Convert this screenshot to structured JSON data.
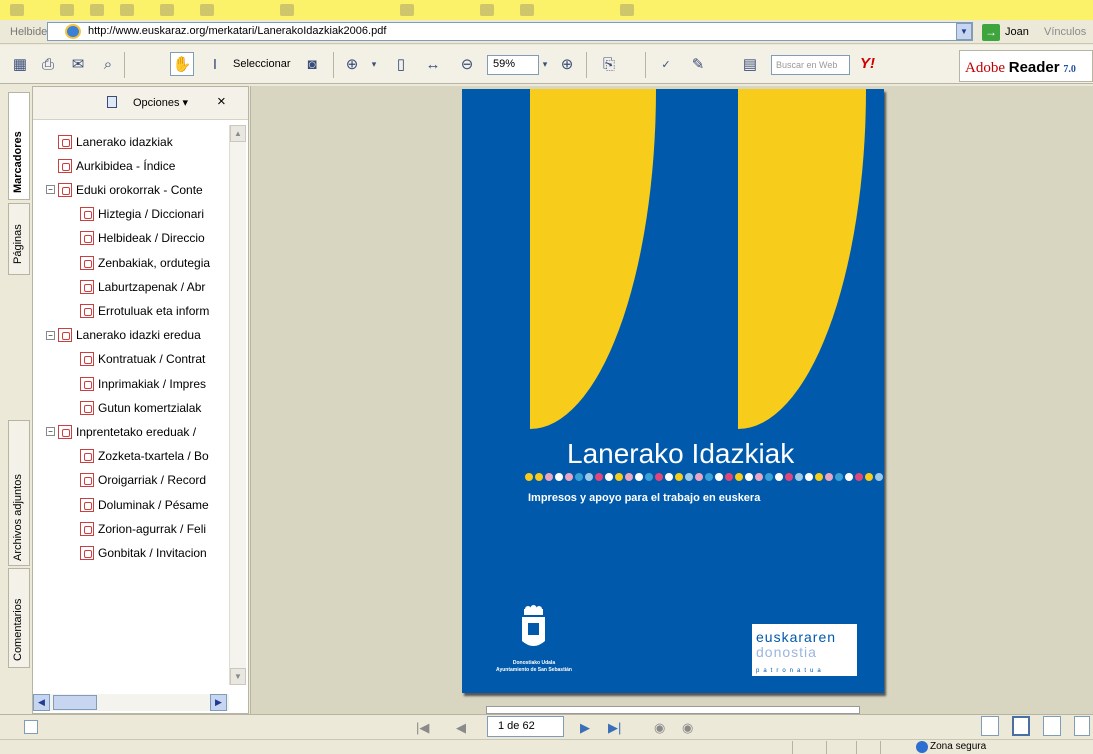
{
  "browser": {
    "address_label": "Helbidea",
    "url": "http://www.euskaraz.org/merkatari/LanerakoIdazkiak2006.pdf",
    "go_label": "Joan",
    "links_label": "Vínculos"
  },
  "toolbar": {
    "select_label": "Seleccionar",
    "zoom_value": "59%",
    "search_placeholder": "Buscar en Web",
    "yahoo_label": "Y!",
    "brand_adobe": "Adobe",
    "brand_reader": "Reader",
    "brand_version": "7.0"
  },
  "side_tabs": [
    "Marcadores",
    "Páginas",
    "Archivos adjuntos",
    "Comentarios"
  ],
  "panel": {
    "options_label": "Opciones",
    "close_label": "×"
  },
  "bookmarks": [
    {
      "label": "Lanerako idazkiak",
      "level": 0,
      "expander": ""
    },
    {
      "label": "Aurkibidea - Índice",
      "level": 0,
      "expander": ""
    },
    {
      "label": "Eduki orokorrak - Conte",
      "level": 0,
      "expander": "−"
    },
    {
      "label": "Hiztegia / Diccionari",
      "level": 1,
      "expander": ""
    },
    {
      "label": "Helbideak / Direccio",
      "level": 1,
      "expander": ""
    },
    {
      "label": "Zenbakiak, ordutegia",
      "level": 1,
      "expander": ""
    },
    {
      "label": "Laburtzapenak / Abr",
      "level": 1,
      "expander": ""
    },
    {
      "label": "Errotuluak eta inform",
      "level": 1,
      "expander": ""
    },
    {
      "label": "Lanerako idazki eredua",
      "level": 0,
      "expander": "−"
    },
    {
      "label": "Kontratuak / Contrat",
      "level": 1,
      "expander": ""
    },
    {
      "label": "Inprimakiak / Impres",
      "level": 1,
      "expander": ""
    },
    {
      "label": "Gutun komertzialak",
      "level": 1,
      "expander": ""
    },
    {
      "label": "Inprentetako ereduak /",
      "level": 0,
      "expander": "−"
    },
    {
      "label": "Zozketa-txartela / Bo",
      "level": 1,
      "expander": ""
    },
    {
      "label": "Oroigarriak / Record",
      "level": 1,
      "expander": ""
    },
    {
      "label": "Doluminak / Pésame",
      "level": 1,
      "expander": ""
    },
    {
      "label": "Zorion-agurrak / Feli",
      "level": 1,
      "expander": ""
    },
    {
      "label": "Gonbitak / Invitacion",
      "level": 1,
      "expander": ""
    }
  ],
  "document": {
    "title": "Lanerako Idazkiak",
    "subtitle": "Impresos y apoyo para el trabajo en euskera",
    "city_line1": "Donostiako Udala",
    "city_line2": "Ayuntamiento de San Sebastián",
    "logo_top": "euskararen",
    "logo_mid": "donostia",
    "logo_bottom": "patronatua",
    "dot_colors": [
      "#f7cc1a",
      "#f7cc1a",
      "#e8a6c0",
      "#ffffff",
      "#e8a6c0",
      "#3aa0d8",
      "#9cc9e8",
      "#e0467a",
      "#ffffff",
      "#f7cc1a",
      "#e8a6c0",
      "#ffffff",
      "#3aa0d8",
      "#e0467a",
      "#ffffff",
      "#f7cc1a",
      "#9cc9e8",
      "#e8a6c0",
      "#3aa0d8",
      "#ffffff",
      "#e0467a",
      "#f7cc1a",
      "#ffffff",
      "#e8a6c0",
      "#3aa0d8",
      "#ffffff",
      "#e0467a",
      "#9cc9e8",
      "#ffffff",
      "#f7cc1a",
      "#e8a6c0",
      "#3aa0d8",
      "#ffffff",
      "#e0467a",
      "#f7cc1a",
      "#9cc9e8",
      "#ffffff",
      "#e8a6c0"
    ]
  },
  "navigation": {
    "page_indicator": "1 de 62"
  },
  "status": {
    "zone_label": "Zona segura"
  },
  "colors": {
    "cover_blue": "#0059ab",
    "quote_yellow": "#f7cc1a"
  }
}
